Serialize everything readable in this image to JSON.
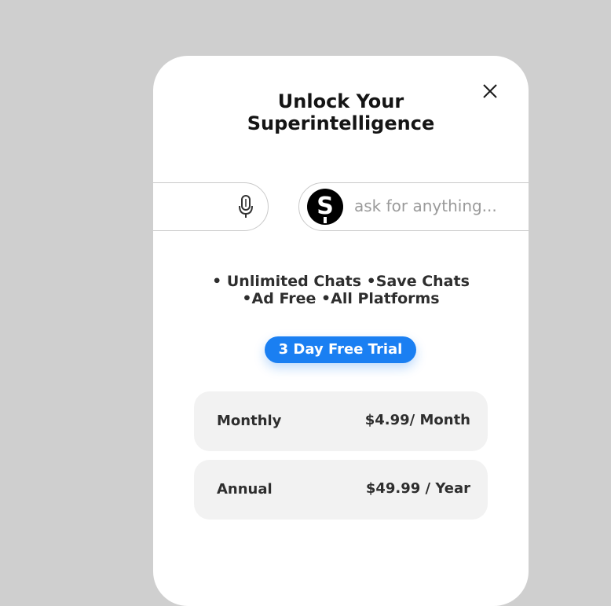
{
  "modal": {
    "title_line1": "Unlock Your",
    "title_line2": "Superintelligence",
    "close_icon": "close-icon"
  },
  "input_bar": {
    "placeholder": "ask for anything...",
    "logo_letter": "S",
    "mic_icon": "microphone-icon"
  },
  "features": {
    "line1": "• Unlimited Chats •Save Chats",
    "line2": "•Ad Free •All Platforms"
  },
  "trial_button": {
    "label": "3 Day Free Trial",
    "color": "#1a7ff2"
  },
  "plans": [
    {
      "name": "Monthly",
      "price": "$4.99/ Month"
    },
    {
      "name": "Annual",
      "price": "$49.99 / Year"
    }
  ],
  "colors": {
    "background": "#cfcfcf",
    "card": "#ffffff",
    "plan_card": "#f2f2f2"
  }
}
